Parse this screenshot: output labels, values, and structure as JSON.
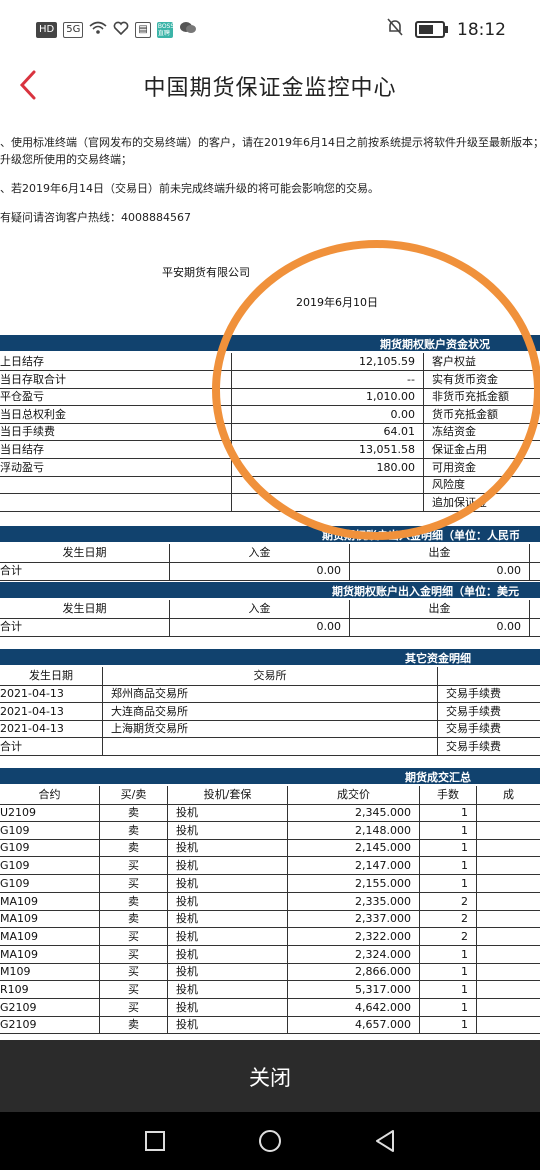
{
  "status_bar": {
    "left_icons": [
      "HD",
      "5G",
      "wifi-icon",
      "heart-icon",
      "app-icon",
      "boss-icon",
      "wechat-icon"
    ],
    "left_labels": {
      "hd": "HD",
      "net": "5G",
      "app": "BOSS 直聘"
    },
    "time": "18:12",
    "battery_level": 0.55
  },
  "header": {
    "title": "中国期货保证金监控中心"
  },
  "notice": {
    "line1": "、使用标准终端（官网发布的交易终端）的客户，请在2019年6月14日之前按系统提示将软件升级至最新版本；",
    "line2": "升级您所使用的交易终端；",
    "line3": "、若2019年6月14日（交易日）前未完成终端升级的将可能会影响您的交易。",
    "line4": "有疑问请咨询客户热线：4008884567",
    "company": "平安期货有限公司",
    "date": "2019年6月10日"
  },
  "account_status": {
    "header": "期货期权账户资金状况",
    "rows": [
      {
        "label": "上日结存",
        "value": "12,105.59",
        "right_label": "客户权益"
      },
      {
        "label": "当日存取合计",
        "value": "--",
        "right_label": "实有货币资金"
      },
      {
        "label": "平仓盈亏",
        "value": "1,010.00",
        "right_label": "非货币充抵金额"
      },
      {
        "label": "当日总权利金",
        "value": "0.00",
        "right_label": "货币充抵金额"
      },
      {
        "label": "当日手续费",
        "value": "64.01",
        "right_label": "冻结资金"
      },
      {
        "label": "当日结存",
        "value": "13,051.58",
        "right_label": "保证金占用"
      },
      {
        "label": "浮动盈亏",
        "value": "180.00",
        "right_label": "可用资金"
      },
      {
        "label": "",
        "value": "",
        "right_label": "风险度"
      },
      {
        "label": "",
        "value": "",
        "right_label": "追加保证金"
      }
    ]
  },
  "rmb_inout": {
    "header": "期货期权账户出入金明细（单位：人民币",
    "cols": [
      "发生日期",
      "入金",
      "出金"
    ],
    "total_label": "合计",
    "total_in": "0.00",
    "total_out": "0.00"
  },
  "usd_inout": {
    "header": "期货期权账户出入金明细（单位：美元",
    "cols": [
      "发生日期",
      "入金",
      "出金"
    ],
    "total_label": "合计",
    "total_in": "0.00",
    "total_out": "0.00"
  },
  "other_funds": {
    "header": "其它资金明细",
    "cols": [
      "发生日期",
      "交易所"
    ],
    "rows": [
      {
        "date": "2021-04-13",
        "exchange": "郑州商品交易所",
        "type": "交易手续费"
      },
      {
        "date": "2021-04-13",
        "exchange": "大连商品交易所",
        "type": "交易手续费"
      },
      {
        "date": "2021-04-13",
        "exchange": "上海期货交易所",
        "type": "交易手续费"
      },
      {
        "date": "合计",
        "exchange": "",
        "type": "交易手续费"
      }
    ]
  },
  "trades": {
    "header": "期货成交汇总",
    "cols": [
      "合约",
      "买/卖",
      "投机/套保",
      "成交价",
      "手数",
      "成"
    ],
    "rows": [
      {
        "contract": "U2109",
        "side": "卖",
        "type": "投机",
        "price": "2,345.000",
        "qty": "1"
      },
      {
        "contract": "G109",
        "side": "卖",
        "type": "投机",
        "price": "2,148.000",
        "qty": "1"
      },
      {
        "contract": "G109",
        "side": "卖",
        "type": "投机",
        "price": "2,145.000",
        "qty": "1"
      },
      {
        "contract": "G109",
        "side": "买",
        "type": "投机",
        "price": "2,147.000",
        "qty": "1"
      },
      {
        "contract": "G109",
        "side": "买",
        "type": "投机",
        "price": "2,155.000",
        "qty": "1"
      },
      {
        "contract": "MA109",
        "side": "卖",
        "type": "投机",
        "price": "2,335.000",
        "qty": "2"
      },
      {
        "contract": "MA109",
        "side": "卖",
        "type": "投机",
        "price": "2,337.000",
        "qty": "2"
      },
      {
        "contract": "MA109",
        "side": "买",
        "type": "投机",
        "price": "2,322.000",
        "qty": "2"
      },
      {
        "contract": "MA109",
        "side": "买",
        "type": "投机",
        "price": "2,324.000",
        "qty": "1"
      },
      {
        "contract": "M109",
        "side": "买",
        "type": "投机",
        "price": "2,866.000",
        "qty": "1"
      },
      {
        "contract": "R109",
        "side": "买",
        "type": "投机",
        "price": "5,317.000",
        "qty": "1"
      },
      {
        "contract": "G2109",
        "side": "买",
        "type": "投机",
        "price": "4,642.000",
        "qty": "1"
      },
      {
        "contract": "G2109",
        "side": "卖",
        "type": "投机",
        "price": "4,657.000",
        "qty": "1"
      }
    ]
  },
  "footer": {
    "close_label": "关闭"
  },
  "colors": {
    "header_blue": "#11426e",
    "accent_red": "#d9333f",
    "annotation_orange": "#f0913b"
  }
}
